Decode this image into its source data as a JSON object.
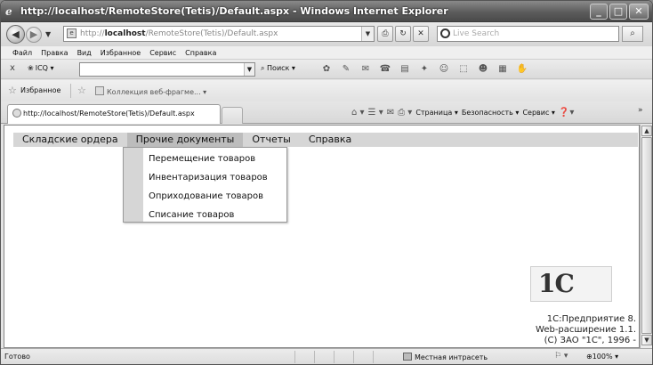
{
  "window": {
    "title": "http://localhost/RemoteStore(Tetis)/Default.aspx - Windows Internet Explorer",
    "minimize": "_",
    "maximize": "□",
    "close": "✕"
  },
  "address": {
    "prefix": "http://",
    "host": "localhost",
    "path": "/RemoteStore(Tetis)/Default.aspx",
    "search_placeholder": "Live Search"
  },
  "menubar": [
    "Файл",
    "Правка",
    "Вид",
    "Избранное",
    "Сервис",
    "Справка"
  ],
  "icq_toolbar": {
    "close": "x",
    "icq_label": "ICQ",
    "search_label": "Поиск"
  },
  "favorites": {
    "label": "Избранное",
    "webslice": "Коллекция веб-фрагме..."
  },
  "tab": {
    "label": "http://localhost/RemoteStore(Tetis)/Default.aspx"
  },
  "commandbar": {
    "page": "Страница",
    "safety": "Безопасность",
    "tools": "Сервис",
    "more": "»"
  },
  "app_menu": {
    "items": [
      "Складские ордера",
      "Прочие документы",
      "Отчеты",
      "Справка"
    ],
    "active_index": 1,
    "dropdown": [
      "Перемещение товаров",
      "Инвентаризация товаров",
      "Оприходование товаров",
      "Списание товаров"
    ]
  },
  "footer": {
    "line1": "1С:Предприятие 8.",
    "line2": "Web-расширение 1.1.",
    "line3": "(С) ЗАО \"1С\", 1996 -"
  },
  "logo_text": "1С",
  "statusbar": {
    "ready": "Готово",
    "zone": "Местная интрасеть",
    "zoom": "100%"
  }
}
